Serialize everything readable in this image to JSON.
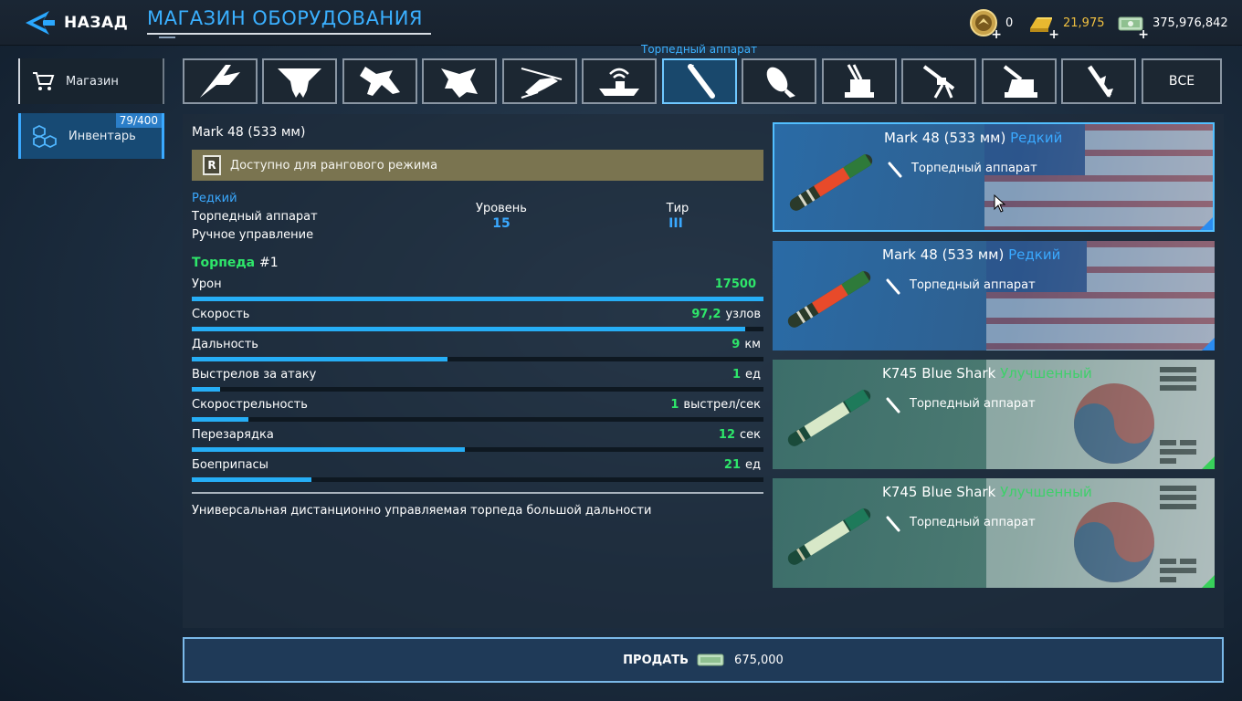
{
  "header": {
    "back_label": "НАЗАД",
    "title": "МАГАЗИН ОБОРУДОВАНИЯ",
    "currencies": [
      {
        "name": "medals",
        "value": "0"
      },
      {
        "name": "gold",
        "value": "21,975"
      },
      {
        "name": "cash",
        "value": "375,976,842"
      }
    ]
  },
  "sidebar": {
    "items": [
      {
        "label": "Магазин",
        "icon": "cart-icon"
      },
      {
        "label": "Инвентарь",
        "icon": "boxes-icon",
        "count": "79/400",
        "active": true
      }
    ]
  },
  "categories": {
    "active_label": "Торпедный аппарат",
    "items": [
      {
        "icon": "stealth-bomber-icon"
      },
      {
        "icon": "flying-wing-icon"
      },
      {
        "icon": "fighter-jet-icon"
      },
      {
        "icon": "stealth-fighter-icon"
      },
      {
        "icon": "helicopter-icon"
      },
      {
        "icon": "radar-ship-icon"
      },
      {
        "icon": "torpedo-icon",
        "active": true
      },
      {
        "icon": "bomb-icon"
      },
      {
        "icon": "anti-air-turret-icon"
      },
      {
        "icon": "machine-gun-icon"
      },
      {
        "icon": "naval-gun-icon"
      },
      {
        "icon": "missile-icon"
      }
    ],
    "all_label": "ВСЕ"
  },
  "detail": {
    "name": "Mark 48 (533 мм)",
    "ranked_notice": "Доступно для рангового режима",
    "ranked_icon_letter": "R",
    "rarity": "Редкий",
    "type": "Торпедный аппарат",
    "control": "Ручное управление",
    "level_label": "Уровень",
    "level_value": "15",
    "tier_label": "Тир",
    "tier_value": "III",
    "weapon_label": "Торпеда",
    "weapon_num": "#1",
    "stats": [
      {
        "name": "Урон",
        "value": "17500",
        "unit": "",
        "fill": 1.0
      },
      {
        "name": "Скорость",
        "value": "97,2",
        "unit": "узлов",
        "fill": 0.968
      },
      {
        "name": "Дальность",
        "value": "9",
        "unit": "км",
        "fill": 0.447
      },
      {
        "name": "Выстрелов за атаку",
        "value": "1",
        "unit": "ед",
        "fill": 0.05
      },
      {
        "name": "Скорострельность",
        "value": "1",
        "unit": "выстрел/сек",
        "fill": 0.099
      },
      {
        "name": "Перезарядка",
        "value": "12",
        "unit": "сек",
        "fill": 0.478
      },
      {
        "name": "Боеприпасы",
        "value": "21",
        "unit": "ед",
        "fill": 0.21
      }
    ],
    "description": "Универсальная дистанционно управляемая торпеда большой дальности"
  },
  "cards": [
    {
      "name": "Mark 48 (533 мм)",
      "rarity": "Редкий",
      "type": "Торпедный аппарат",
      "kind": "rare",
      "flag": "usa-flag",
      "selected": true
    },
    {
      "name": "Mark 48 (533 мм)",
      "rarity": "Редкий",
      "type": "Торпедный аппарат",
      "kind": "rare",
      "flag": "usa-flag",
      "selected": false
    },
    {
      "name": "K745 Blue Shark",
      "rarity": "Улучшенный",
      "type": "Торпедный аппарат",
      "kind": "improved",
      "flag": "korea-flag",
      "selected": false
    },
    {
      "name": "K745 Blue Shark",
      "rarity": "Улучшенный",
      "type": "Торпедный аппарат",
      "kind": "improved",
      "flag": "korea-flag",
      "selected": false
    }
  ],
  "sell": {
    "label": "ПРОДАТЬ",
    "price": "675,000"
  },
  "colors": {
    "accent": "#3aa9ff",
    "green": "#2ee66a",
    "gold": "#f0c040"
  }
}
